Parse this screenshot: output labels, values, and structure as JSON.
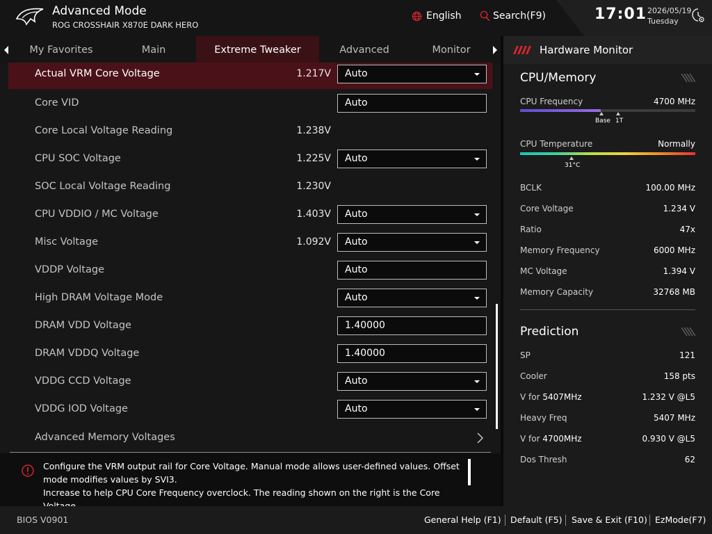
{
  "header": {
    "title": "Advanced Mode",
    "subtitle": "ROG CROSSHAIR X870E DARK HERO",
    "language": "English",
    "search": "Search(F9)",
    "time": "17:01",
    "date": "2026/05/19",
    "day": "Tuesday"
  },
  "tabs": [
    {
      "label": "My Favorites"
    },
    {
      "label": "Main"
    },
    {
      "label": "Extreme Tweaker",
      "active": true
    },
    {
      "label": "Advanced"
    },
    {
      "label": "Monitor"
    }
  ],
  "rows": [
    {
      "label": "Actual VRM Core Voltage",
      "value": "1.217V",
      "control": "Auto",
      "dropdown": true
    },
    {
      "label": "Core VID",
      "value": "",
      "control": "Auto",
      "dropdown": false
    },
    {
      "label": "Core Local Voltage Reading",
      "value": "1.238V",
      "control": "",
      "dropdown": false
    },
    {
      "label": "CPU SOC Voltage",
      "value": "1.225V",
      "control": "Auto",
      "dropdown": true
    },
    {
      "label": "SOC Local Voltage Reading",
      "value": "1.230V",
      "control": "",
      "dropdown": false
    },
    {
      "label": "CPU VDDIO / MC Voltage",
      "value": "1.403V",
      "control": "Auto",
      "dropdown": true
    },
    {
      "label": "Misc Voltage",
      "value": "1.092V",
      "control": "Auto",
      "dropdown": true
    },
    {
      "label": "VDDP Voltage",
      "value": "",
      "control": "Auto",
      "dropdown": false
    },
    {
      "label": "High DRAM Voltage Mode",
      "value": "",
      "control": "Auto",
      "dropdown": true
    },
    {
      "label": "DRAM VDD Voltage",
      "value": "",
      "control": "1.40000",
      "dropdown": false
    },
    {
      "label": "DRAM VDDQ Voltage",
      "value": "",
      "control": "1.40000",
      "dropdown": false
    },
    {
      "label": "VDDG CCD Voltage",
      "value": "",
      "control": "Auto",
      "dropdown": true
    },
    {
      "label": "VDDG IOD Voltage",
      "value": "",
      "control": "Auto",
      "dropdown": true
    }
  ],
  "submenu": {
    "label": "Advanced Memory Voltages"
  },
  "help": {
    "line1": "Configure the VRM output rail for Core Voltage. Manual mode allows user-defined values. Offset mode modifies values by SVI3.",
    "line2": "Increase to help CPU Core Frequency overclock. The reading shown on the right is the Core Voltage"
  },
  "footer": {
    "bios": "BIOS V0901",
    "general_help": "General Help (F1)",
    "default": "Default (F5)",
    "save_exit": "Save & Exit (F10)",
    "ezmode": "EzMode(F7)"
  },
  "hw": {
    "title": "Hardware Monitor",
    "cpu_section": "CPU/Memory",
    "cpu_freq_label": "CPU Frequency",
    "cpu_freq_value": "4700 MHz",
    "cpu_freq_fill": 0.46,
    "base_label": "Base",
    "t1_label": "1T",
    "cpu_temp_label": "CPU Temperature",
    "cpu_temp_value": "Normally",
    "cpu_temp_marker": "31°C",
    "items": [
      {
        "label": "BCLK",
        "value": "100.00 MHz"
      },
      {
        "label": "Core Voltage",
        "value": "1.234 V"
      },
      {
        "label": "Ratio",
        "value": "47x"
      },
      {
        "label": "Memory Frequency",
        "value": "6000 MHz"
      },
      {
        "label": "MC Voltage",
        "value": "1.394 V"
      },
      {
        "label": "Memory Capacity",
        "value": "32768 MB"
      }
    ],
    "prediction_section": "Prediction",
    "prediction": [
      {
        "label": "SP",
        "value": "121"
      },
      {
        "label": "Cooler",
        "value": "158 pts"
      },
      {
        "label_pre": "V for ",
        "label_bold": "5407MHz",
        "value": "1.232 V @L5"
      },
      {
        "label": "Heavy Freq",
        "value": "5407 MHz"
      },
      {
        "label_pre": "V for ",
        "label_bold": "4700MHz",
        "value": "0.930 V @L5"
      },
      {
        "label": "Dos Thresh",
        "value": "62"
      }
    ]
  },
  "colors": {
    "accent": "#d7242f",
    "selected_row": "#4a1218",
    "background": "#171717"
  }
}
